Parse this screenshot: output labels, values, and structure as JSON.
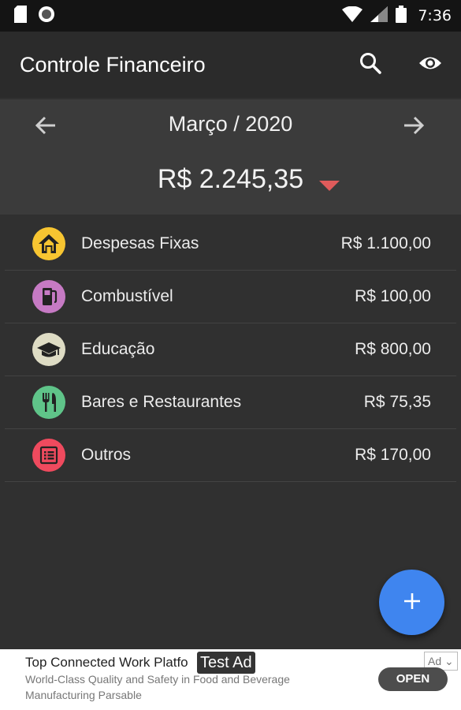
{
  "status_bar": {
    "time": "7:36",
    "icons": [
      "sd-card-icon",
      "circle-notification-icon",
      "wifi-icon",
      "signal-icon",
      "battery-icon"
    ]
  },
  "app_bar": {
    "title": "Controle Financeiro",
    "actions": [
      "search-icon",
      "eye-icon"
    ]
  },
  "summary": {
    "month": "Março / 2020",
    "total": "R$ 2.245,35",
    "trend_color": "#e05b5b"
  },
  "categories": [
    {
      "name": "Despesas Fixas",
      "value": "R$ 1.100,00",
      "icon": "home-icon",
      "color": "#f7c531"
    },
    {
      "name": "Combustível",
      "value": "R$ 100,00",
      "icon": "fuel-pump-icon",
      "color": "#c67ac4"
    },
    {
      "name": "Educação",
      "value": "R$ 800,00",
      "icon": "graduation-cap-icon",
      "color": "#dedcc4"
    },
    {
      "name": "Bares e Restaurantes",
      "value": "R$ 75,35",
      "icon": "fork-knife-icon",
      "color": "#5fc489"
    },
    {
      "name": "Outros",
      "value": "R$ 170,00",
      "icon": "list-icon",
      "color": "#ef4a5e"
    }
  ],
  "fab": {
    "icon": "plus-icon",
    "color": "#3f85ef"
  },
  "ad": {
    "title": "Top Connected Work Platfo",
    "description_line1": "World-Class Quality and Safety in Food and Beverage",
    "description_line2": "Manufacturing Parsable",
    "test_label": "Test Ad",
    "badge": "Ad",
    "cta": "OPEN"
  }
}
